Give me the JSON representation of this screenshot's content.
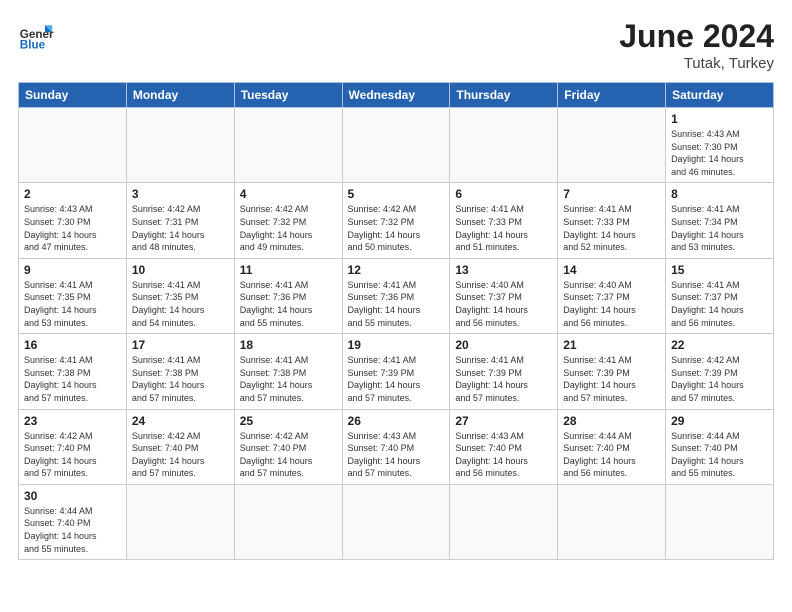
{
  "header": {
    "logo_general": "General",
    "logo_blue": "Blue",
    "title": "June 2024",
    "subtitle": "Tutak, Turkey"
  },
  "weekdays": [
    "Sunday",
    "Monday",
    "Tuesday",
    "Wednesday",
    "Thursday",
    "Friday",
    "Saturday"
  ],
  "weeks": [
    [
      {
        "day": "",
        "info": ""
      },
      {
        "day": "",
        "info": ""
      },
      {
        "day": "",
        "info": ""
      },
      {
        "day": "",
        "info": ""
      },
      {
        "day": "",
        "info": ""
      },
      {
        "day": "",
        "info": ""
      },
      {
        "day": "1",
        "info": "Sunrise: 4:43 AM\nSunset: 7:30 PM\nDaylight: 14 hours\nand 46 minutes."
      }
    ],
    [
      {
        "day": "2",
        "info": "Sunrise: 4:43 AM\nSunset: 7:30 PM\nDaylight: 14 hours\nand 47 minutes."
      },
      {
        "day": "3",
        "info": "Sunrise: 4:42 AM\nSunset: 7:31 PM\nDaylight: 14 hours\nand 48 minutes."
      },
      {
        "day": "4",
        "info": "Sunrise: 4:42 AM\nSunset: 7:32 PM\nDaylight: 14 hours\nand 49 minutes."
      },
      {
        "day": "5",
        "info": "Sunrise: 4:42 AM\nSunset: 7:32 PM\nDaylight: 14 hours\nand 50 minutes."
      },
      {
        "day": "6",
        "info": "Sunrise: 4:41 AM\nSunset: 7:33 PM\nDaylight: 14 hours\nand 51 minutes."
      },
      {
        "day": "7",
        "info": "Sunrise: 4:41 AM\nSunset: 7:33 PM\nDaylight: 14 hours\nand 52 minutes."
      },
      {
        "day": "8",
        "info": "Sunrise: 4:41 AM\nSunset: 7:34 PM\nDaylight: 14 hours\nand 53 minutes."
      }
    ],
    [
      {
        "day": "9",
        "info": "Sunrise: 4:41 AM\nSunset: 7:35 PM\nDaylight: 14 hours\nand 53 minutes."
      },
      {
        "day": "10",
        "info": "Sunrise: 4:41 AM\nSunset: 7:35 PM\nDaylight: 14 hours\nand 54 minutes."
      },
      {
        "day": "11",
        "info": "Sunrise: 4:41 AM\nSunset: 7:36 PM\nDaylight: 14 hours\nand 55 minutes."
      },
      {
        "day": "12",
        "info": "Sunrise: 4:41 AM\nSunset: 7:36 PM\nDaylight: 14 hours\nand 55 minutes."
      },
      {
        "day": "13",
        "info": "Sunrise: 4:40 AM\nSunset: 7:37 PM\nDaylight: 14 hours\nand 56 minutes."
      },
      {
        "day": "14",
        "info": "Sunrise: 4:40 AM\nSunset: 7:37 PM\nDaylight: 14 hours\nand 56 minutes."
      },
      {
        "day": "15",
        "info": "Sunrise: 4:41 AM\nSunset: 7:37 PM\nDaylight: 14 hours\nand 56 minutes."
      }
    ],
    [
      {
        "day": "16",
        "info": "Sunrise: 4:41 AM\nSunset: 7:38 PM\nDaylight: 14 hours\nand 57 minutes."
      },
      {
        "day": "17",
        "info": "Sunrise: 4:41 AM\nSunset: 7:38 PM\nDaylight: 14 hours\nand 57 minutes."
      },
      {
        "day": "18",
        "info": "Sunrise: 4:41 AM\nSunset: 7:38 PM\nDaylight: 14 hours\nand 57 minutes."
      },
      {
        "day": "19",
        "info": "Sunrise: 4:41 AM\nSunset: 7:39 PM\nDaylight: 14 hours\nand 57 minutes."
      },
      {
        "day": "20",
        "info": "Sunrise: 4:41 AM\nSunset: 7:39 PM\nDaylight: 14 hours\nand 57 minutes."
      },
      {
        "day": "21",
        "info": "Sunrise: 4:41 AM\nSunset: 7:39 PM\nDaylight: 14 hours\nand 57 minutes."
      },
      {
        "day": "22",
        "info": "Sunrise: 4:42 AM\nSunset: 7:39 PM\nDaylight: 14 hours\nand 57 minutes."
      }
    ],
    [
      {
        "day": "23",
        "info": "Sunrise: 4:42 AM\nSunset: 7:40 PM\nDaylight: 14 hours\nand 57 minutes."
      },
      {
        "day": "24",
        "info": "Sunrise: 4:42 AM\nSunset: 7:40 PM\nDaylight: 14 hours\nand 57 minutes."
      },
      {
        "day": "25",
        "info": "Sunrise: 4:42 AM\nSunset: 7:40 PM\nDaylight: 14 hours\nand 57 minutes."
      },
      {
        "day": "26",
        "info": "Sunrise: 4:43 AM\nSunset: 7:40 PM\nDaylight: 14 hours\nand 57 minutes."
      },
      {
        "day": "27",
        "info": "Sunrise: 4:43 AM\nSunset: 7:40 PM\nDaylight: 14 hours\nand 56 minutes."
      },
      {
        "day": "28",
        "info": "Sunrise: 4:44 AM\nSunset: 7:40 PM\nDaylight: 14 hours\nand 56 minutes."
      },
      {
        "day": "29",
        "info": "Sunrise: 4:44 AM\nSunset: 7:40 PM\nDaylight: 14 hours\nand 55 minutes."
      }
    ],
    [
      {
        "day": "30",
        "info": "Sunrise: 4:44 AM\nSunset: 7:40 PM\nDaylight: 14 hours\nand 55 minutes."
      },
      {
        "day": "",
        "info": ""
      },
      {
        "day": "",
        "info": ""
      },
      {
        "day": "",
        "info": ""
      },
      {
        "day": "",
        "info": ""
      },
      {
        "day": "",
        "info": ""
      },
      {
        "day": "",
        "info": ""
      }
    ]
  ]
}
